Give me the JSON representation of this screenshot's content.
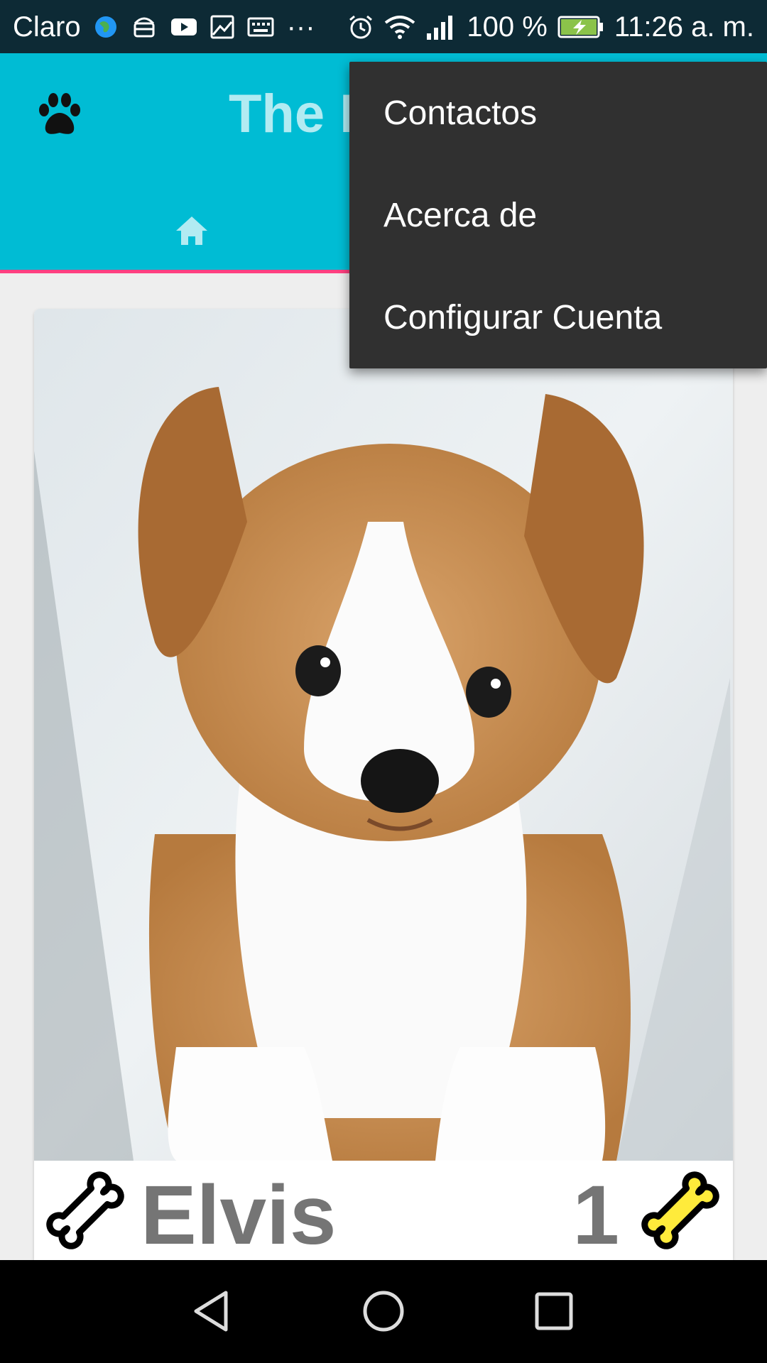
{
  "status_bar": {
    "carrier": "Claro",
    "overflow_dots": "···",
    "battery_percent": "100 %",
    "time": "11:26 a. m.",
    "icons": [
      "globe-icon",
      "android-icon",
      "youtube-icon",
      "image-icon",
      "keyboard-icon",
      "alarm-icon",
      "wifi-icon",
      "signal-icon",
      "battery-charging-icon"
    ]
  },
  "app_bar": {
    "title": "The B",
    "icon": "paw-icon",
    "background_color": "#00bcd4",
    "title_color": "#b2ebf2"
  },
  "tabs": [
    {
      "icon": "home-icon",
      "selected": true
    }
  ],
  "tab_indicator_color": "#ff4081",
  "menu": {
    "items": [
      {
        "label": "Contactos"
      },
      {
        "label": "Acerca de"
      },
      {
        "label": "Configurar Cuenta"
      }
    ],
    "background_color": "#303030"
  },
  "pet_card": {
    "name": "Elvis",
    "rating": "1",
    "photo": "puppy-photo",
    "like_icon": "bone-outline-icon",
    "rating_icon": "bone-yellow-icon"
  },
  "nav_bar": {
    "buttons": [
      "back-icon",
      "home-circle-icon",
      "recents-icon"
    ]
  }
}
